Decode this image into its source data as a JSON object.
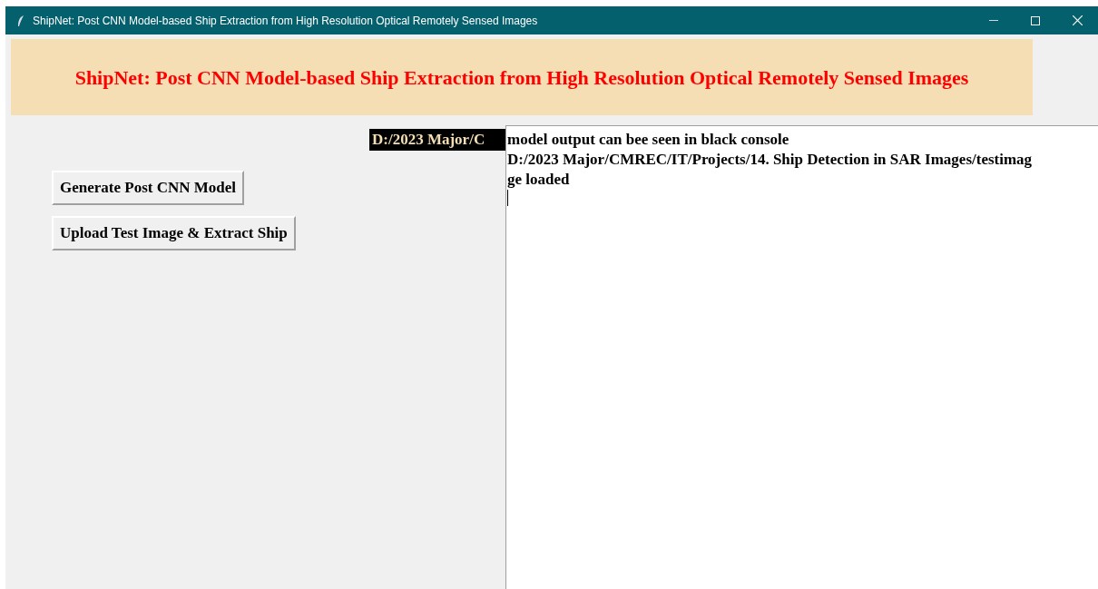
{
  "window": {
    "title": "ShipNet: Post CNN Model-based Ship Extraction from High Resolution Optical Remotely Sensed Images"
  },
  "header": {
    "title": "ShipNet: Post CNN Model-based Ship Extraction from High Resolution Optical Remotely Sensed Images"
  },
  "path_label": "D:/2023 Major/C",
  "buttons": [
    "Generate Post CNN Model",
    "Upload Test Image & Extract Ship"
  ],
  "console": {
    "lines": [
      "model output can bee seen in black console",
      "D:/2023 Major/CMREC/IT/Projects/14. Ship Detection in SAR Images/testimag",
      "ge loaded"
    ]
  }
}
